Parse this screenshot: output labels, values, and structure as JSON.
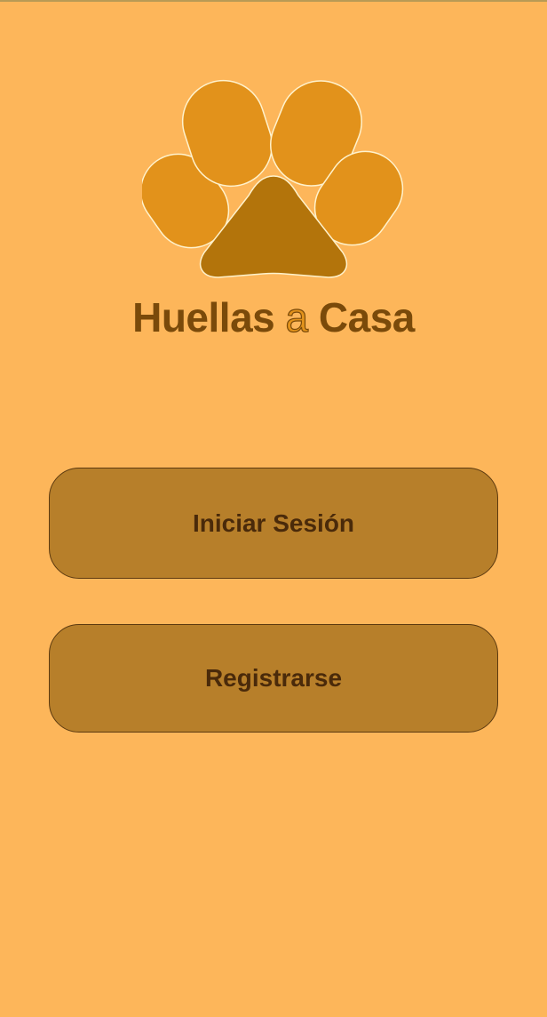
{
  "app": {
    "title_part1": "Huellas",
    "title_part2": "a",
    "title_part3": "Casa",
    "logo": "paw-print-icon"
  },
  "actions": {
    "login_label": "Iniciar Sesión",
    "register_label": "Registrarse"
  },
  "colors": {
    "background": "#fdb65a",
    "paw_toe": "#e2921b",
    "paw_pad": "#b3740b",
    "button": "#b77f2a",
    "title": "#7a4a0a",
    "button_text": "#4a2a0a"
  }
}
